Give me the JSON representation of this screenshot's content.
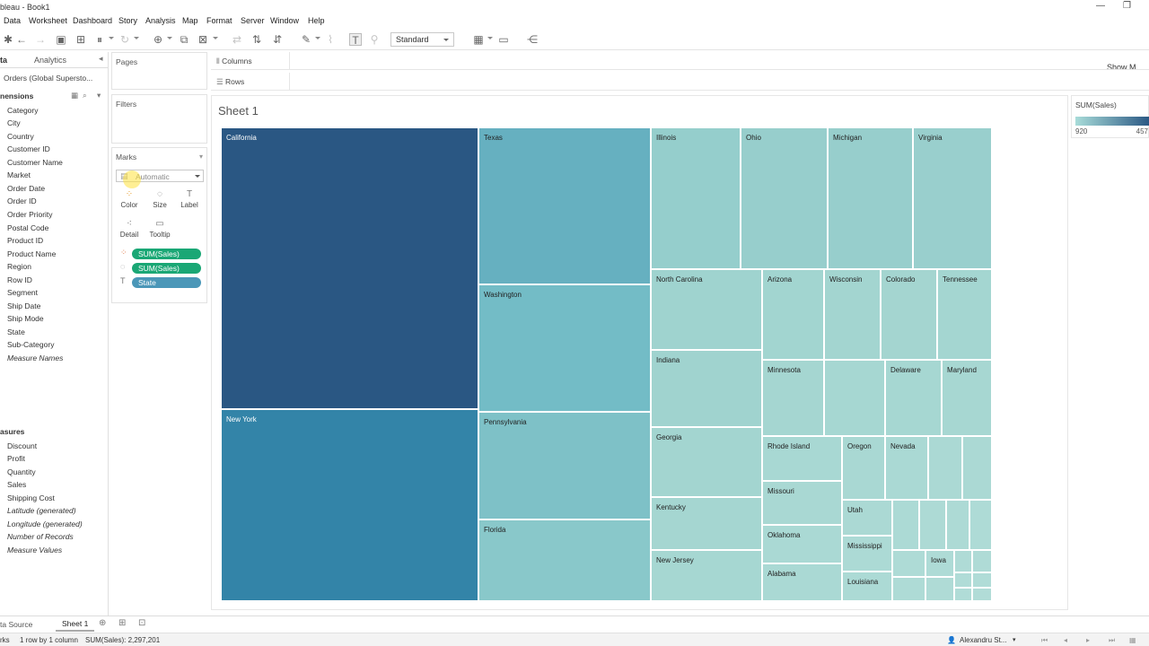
{
  "window": {
    "title": "bleau - Book1",
    "minimize": "—",
    "restore": "❐"
  },
  "menu": [
    "Data",
    "Worksheet",
    "Dashboard",
    "Story",
    "Analysis",
    "Map",
    "Format",
    "Server",
    "Window",
    "Help"
  ],
  "toolbar": {
    "fit_value": "Standard",
    "show_me": "Show M"
  },
  "data_pane": {
    "tab_data": "ta",
    "tab_analytics": "Analytics",
    "source": "Orders (Global Supersto...",
    "dimensions_header": "nensions",
    "dimensions": [
      "Category",
      "City",
      "Country",
      "Customer ID",
      "Customer Name",
      "Market",
      "Order Date",
      "Order ID",
      "Order Priority",
      "Postal Code",
      "Product ID",
      "Product Name",
      "Region",
      "Row ID",
      "Segment",
      "Ship Date",
      "Ship Mode",
      "State",
      "Sub-Category"
    ],
    "dimensions_italic": [
      "Measure Names"
    ],
    "measures_header": "asures",
    "measures": [
      "Discount",
      "Profit",
      "Quantity",
      "Sales",
      "Shipping Cost"
    ],
    "measures_italic": [
      "Latitude (generated)",
      "Longitude (generated)",
      "Number of Records",
      "Measure Values"
    ]
  },
  "cards": {
    "pages": "Pages",
    "filters": "Filters",
    "marks": "Marks",
    "mark_type": "Automatic",
    "buttons": [
      "Color",
      "Size",
      "Label",
      "Detail",
      "Tooltip"
    ],
    "pills": [
      {
        "label": "SUM(Sales)",
        "kind": "green"
      },
      {
        "label": "SUM(Sales)",
        "kind": "green"
      },
      {
        "label": "State",
        "kind": "blue"
      }
    ]
  },
  "shelves": {
    "columns": "Columns",
    "rows": "Rows"
  },
  "sheet": {
    "title": "Sheet 1"
  },
  "legend": {
    "title": "SUM(Sales)",
    "min": "920",
    "max": "457",
    "color_low": "#a8dcd9",
    "color_high": "#2a5783"
  },
  "treemap_labels": {
    "california": "California",
    "new_york": "New York",
    "texas": "Texas",
    "washington": "Washington",
    "pennsylvania": "Pennsylvania",
    "florida": "Florida",
    "illinois": "Illinois",
    "ohio": "Ohio",
    "michigan": "Michigan",
    "virginia": "Virginia",
    "north_carolina": "North Carolina",
    "arizona": "Arizona",
    "wisconsin": "Wisconsin",
    "colorado": "Colorado",
    "tennessee": "Tennessee",
    "indiana": "Indiana",
    "minnesota": "Minnesota",
    "delaware": "Delaware",
    "maryland": "Maryland",
    "georgia": "Georgia",
    "rhode_island": "Rhode Island",
    "oregon": "Oregon",
    "nevada": "Nevada",
    "kentucky": "Kentucky",
    "missouri": "Missouri",
    "utah": "Utah",
    "new_jersey": "New Jersey",
    "oklahoma": "Oklahoma",
    "mississippi": "Mississippi",
    "iowa": "Iowa",
    "alabama": "Alabama",
    "louisiana": "Louisiana"
  },
  "tabs": {
    "data_source": "ta Source",
    "sheet1": "Sheet 1"
  },
  "status": {
    "marks": "rks",
    "layout": "1 row by 1 column",
    "sum": "SUM(Sales): 2,297,201",
    "user": "Alexandru St..."
  }
}
